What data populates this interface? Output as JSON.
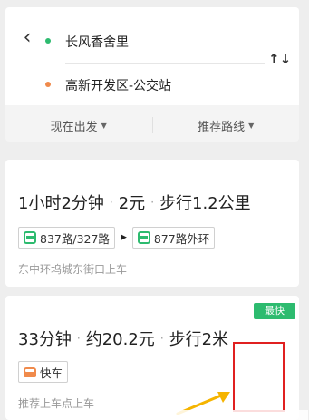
{
  "header": {
    "start": "长风香舍里",
    "end": "高新开发区-公交站",
    "swap_icon": "↑↓"
  },
  "filters": {
    "depart": "现在出发",
    "route": "推荐路线"
  },
  "routes": [
    {
      "duration": "1小时2分钟",
      "price": "2元",
      "walk": "步行1.2公里",
      "lines": [
        "837路/327路",
        "877路外环"
      ],
      "sub": "东中环坞城东街口上车"
    },
    {
      "badge": "最快",
      "duration": "33分钟",
      "price": "约20.2元",
      "walk": "步行2米",
      "mode": "快车",
      "sub": "推荐上车点上车"
    }
  ],
  "colors": {
    "accent": "#2dbb6f",
    "orange": "#f08a4b",
    "annotation_red": "#e02020",
    "annotation_yellow": "#f5b400"
  }
}
